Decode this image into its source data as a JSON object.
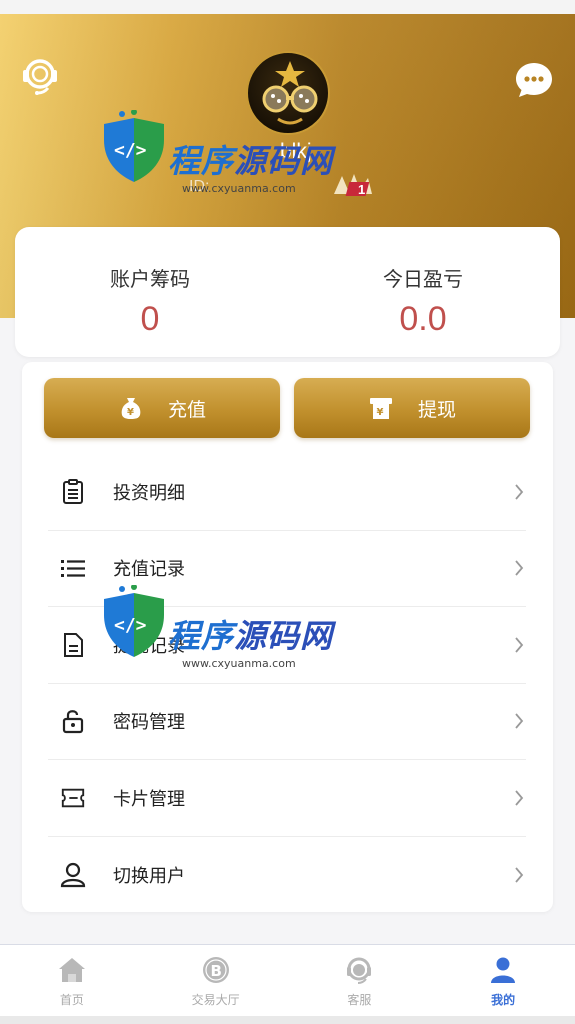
{
  "header": {
    "username": "blkj",
    "user_id": "ID:"
  },
  "watermark": {
    "brand_1": "程序",
    "brand_2": "源码网",
    "url": "www.cxyuanma.com"
  },
  "stats": {
    "balance_label": "账户筹码",
    "balance_value": "0",
    "today_label": "今日盈亏",
    "today_value": "0.0",
    "value_color": "#c0504d"
  },
  "actions": {
    "recharge_label": "充值",
    "withdraw_label": "提现",
    "accent": "#c1902d"
  },
  "menu": {
    "items": [
      {
        "label": "投资明细",
        "icon": "document-list-icon"
      },
      {
        "label": "充值记录",
        "icon": "list-icon"
      },
      {
        "label": "提现记录",
        "icon": "file-icon"
      },
      {
        "label": "密码管理",
        "icon": "lock-icon"
      },
      {
        "label": "卡片管理",
        "icon": "card-icon"
      },
      {
        "label": "切换用户",
        "icon": "user-icon"
      }
    ]
  },
  "tabbar": {
    "tabs": [
      {
        "label": "首页",
        "icon": "home-icon"
      },
      {
        "label": "交易大厅",
        "icon": "bitcoin-icon"
      },
      {
        "label": "客服",
        "icon": "headset-icon"
      },
      {
        "label": "我的",
        "icon": "profile-icon"
      }
    ],
    "active_color": "#3a6fd6"
  }
}
